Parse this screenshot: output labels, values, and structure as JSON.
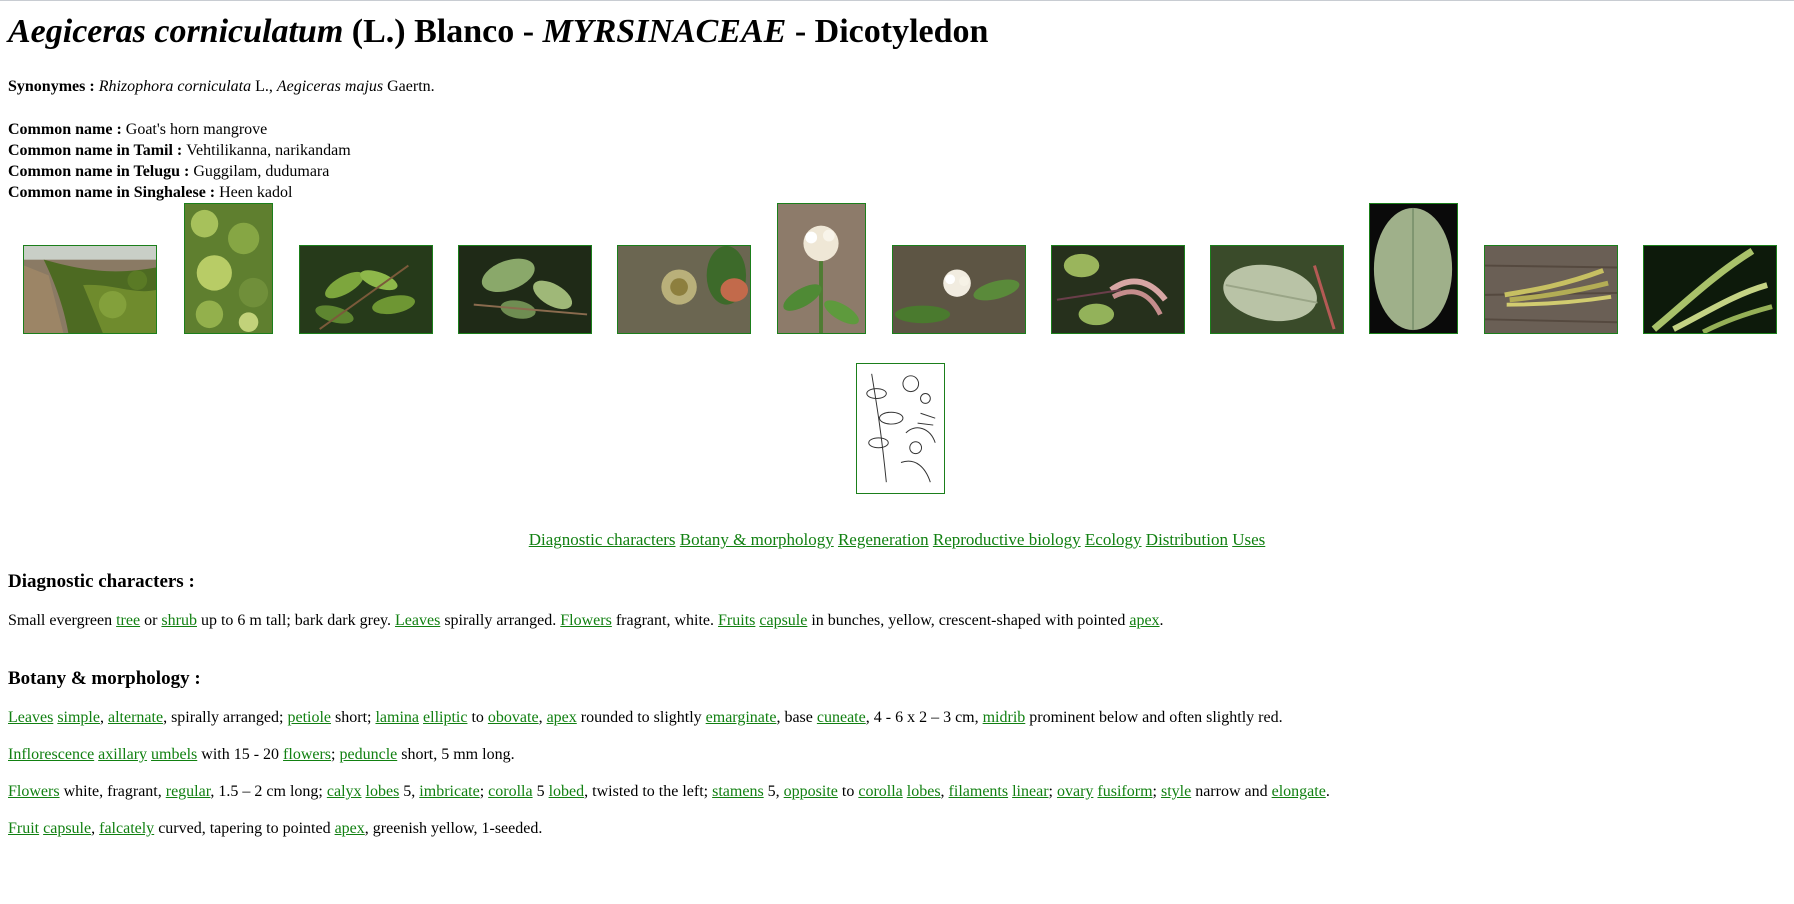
{
  "header": {
    "genus": "Aegiceras corniculatum",
    "author": " (L.) Blanco - ",
    "family": "MYRSINACEAE",
    "group": " - Dicotyledon"
  },
  "synonyms": {
    "label": "Synonymes : ",
    "name1": "Rhizophora corniculata",
    "auth1": " L., ",
    "name2": "Aegiceras majus",
    "auth2": " Gaertn."
  },
  "common_names": [
    {
      "label": "Common name : ",
      "value": "Goat's horn mangrove"
    },
    {
      "label": "Common name in Tamil : ",
      "value": "Vehtilikanna, narikandam"
    },
    {
      "label": "Common name in Telugu : ",
      "value": "Guggilam, dudumara"
    },
    {
      "label": "Common name in Singhalese : ",
      "value": "Heen kadol"
    }
  ],
  "gallery": [
    {
      "name": "mangrove-stand-photo"
    },
    {
      "name": "shrub-foliage-photo"
    },
    {
      "name": "leafy-branch-photo"
    },
    {
      "name": "leaf-closeup-photo"
    },
    {
      "name": "flower-bud-photo"
    },
    {
      "name": "flower-cluster-photo"
    },
    {
      "name": "inflorescence-photo"
    },
    {
      "name": "fruit-bunch-photo"
    },
    {
      "name": "leaf-underside-photo"
    },
    {
      "name": "leaf-detail-photo"
    },
    {
      "name": "fruits-on-wood-photo"
    },
    {
      "name": "fruit-closeup-photo"
    },
    {
      "name": "botanical-drawing"
    }
  ],
  "nav": [
    "Diagnostic characters",
    "Botany & morphology",
    "Regeneration",
    "Reproductive biology",
    "Ecology",
    "Distribution",
    "Uses"
  ],
  "diagnostic": {
    "heading": "Diagnostic characters :",
    "t1": "Small evergreen ",
    "l1": "tree",
    "t2": " or ",
    "l2": "shrub",
    "t3": " up to 6 m tall; bark dark grey. ",
    "l3": "Leaves",
    "t4": " spirally arranged. ",
    "l4": "Flowers",
    "t5": " fragrant, white. ",
    "l5": "Fruits",
    "l6": "capsule",
    "t6": " in bunches, yellow, crescent-shaped with pointed ",
    "l7": "apex",
    "t7": "."
  },
  "botany": {
    "heading": "Botany & morphology :",
    "leaves": {
      "l1": "Leaves",
      "l2": "simple",
      "l3": "alternate",
      "t1": ", spirally arranged; ",
      "l4": "petiole",
      "t2": " short; ",
      "l5": "lamina",
      "l6": "elliptic",
      "t3": " to ",
      "l7": "obovate",
      "l8": "apex",
      "t4": " rounded to slightly ",
      "l9": "emarginate",
      "t5": ", base ",
      "l10": "cuneate",
      "t6": ", 4 - 6 x 2 – 3 cm, ",
      "l11": "midrib",
      "t7": " prominent below and often slightly red."
    },
    "inflorescence": {
      "l1": "Inflorescence",
      "l2": "axillary",
      "l3": "umbels",
      "t1": " with 15 - 20 ",
      "l4": "flowers",
      "l5": "peduncle",
      "t2": " short, 5 mm long."
    },
    "flowers": {
      "l1": "Flowers",
      "t1": " white, fragrant, ",
      "l2": "regular",
      "t2": ", 1.5 – 2 cm long; ",
      "l3": "calyx",
      "l4": "lobes",
      "t3": " 5, ",
      "l5": "imbricate",
      "l6": "corolla",
      "t4": " 5 ",
      "l7": "lobed",
      "t5": ", twisted to the left; ",
      "l8": "stamens",
      "t6": " 5, ",
      "l9": "opposite",
      "t7": " to ",
      "l10": "corolla",
      "l11": "lobes",
      "l12": "filaments",
      "l13": "linear",
      "l14": "ovary",
      "l15": "fusiform",
      "l16": "style",
      "t8": " narrow and ",
      "l17": "elongate",
      "t9": "."
    },
    "fruit": {
      "l1": "Fruit",
      "l2": "capsule",
      "l3": "falcately",
      "t1": " curved, tapering to pointed ",
      "l4": "apex",
      "t2": ", greenish yellow, 1-seeded."
    }
  }
}
